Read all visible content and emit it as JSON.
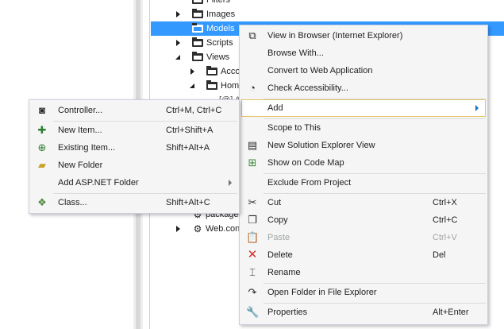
{
  "tree": {
    "items": [
      {
        "label": "Filters",
        "expander": "none",
        "icon": "folder-icon"
      },
      {
        "label": "Images",
        "expander": "collapsed",
        "icon": "folder-icon"
      },
      {
        "label": "Models",
        "expander": "none",
        "icon": "folder-icon",
        "selected": true
      },
      {
        "label": "Scripts",
        "expander": "collapsed",
        "icon": "folder-icon"
      },
      {
        "label": "Views",
        "expander": "expanded",
        "icon": "folder-icon"
      },
      {
        "label": "Acco",
        "expander": "collapsed",
        "icon": "folder-icon"
      },
      {
        "label": "Home",
        "expander": "expanded",
        "icon": "folder-icon"
      },
      {
        "label": "[@] A",
        "expander": "none",
        "icon": "file-icon"
      },
      {
        "label": "package",
        "expander": "none",
        "icon": "config-file-icon"
      },
      {
        "label": "Web.con",
        "expander": "collapsed",
        "icon": "config-file-icon"
      }
    ]
  },
  "context_menu": {
    "view_in_browser": "View in Browser (Internet Explorer)",
    "browse_with": "Browse With...",
    "convert_to_web_app": "Convert to Web Application",
    "check_accessibility": "Check Accessibility...",
    "add": "Add",
    "scope_to_this": "Scope to This",
    "new_solution_explorer_view": "New Solution Explorer View",
    "show_on_code_map": "Show on Code Map",
    "exclude_from_project": "Exclude From Project",
    "cut": "Cut",
    "cut_shortcut": "Ctrl+X",
    "copy": "Copy",
    "copy_shortcut": "Ctrl+C",
    "paste": "Paste",
    "paste_shortcut": "Ctrl+V",
    "delete": "Delete",
    "delete_shortcut": "Del",
    "rename": "Rename",
    "open_folder_in_explorer": "Open Folder in File Explorer",
    "properties": "Properties",
    "properties_shortcut": "Alt+Enter"
  },
  "add_submenu": {
    "controller": "Controller...",
    "controller_shortcut": "Ctrl+M, Ctrl+C",
    "new_item": "New Item...",
    "new_item_shortcut": "Ctrl+Shift+A",
    "existing_item": "Existing Item...",
    "existing_item_shortcut": "Shift+Alt+A",
    "new_folder": "New Folder",
    "add_aspnet_folder": "Add ASP.NET Folder",
    "class": "Class...",
    "class_shortcut": "Shift+Alt+C"
  },
  "colors": {
    "selection": "#3399ff",
    "menu_background": "#f5f5f5",
    "hover_border": "#e5c365",
    "delete_icon": "#d32f2f",
    "disabled_text": "#a2a4a5"
  }
}
